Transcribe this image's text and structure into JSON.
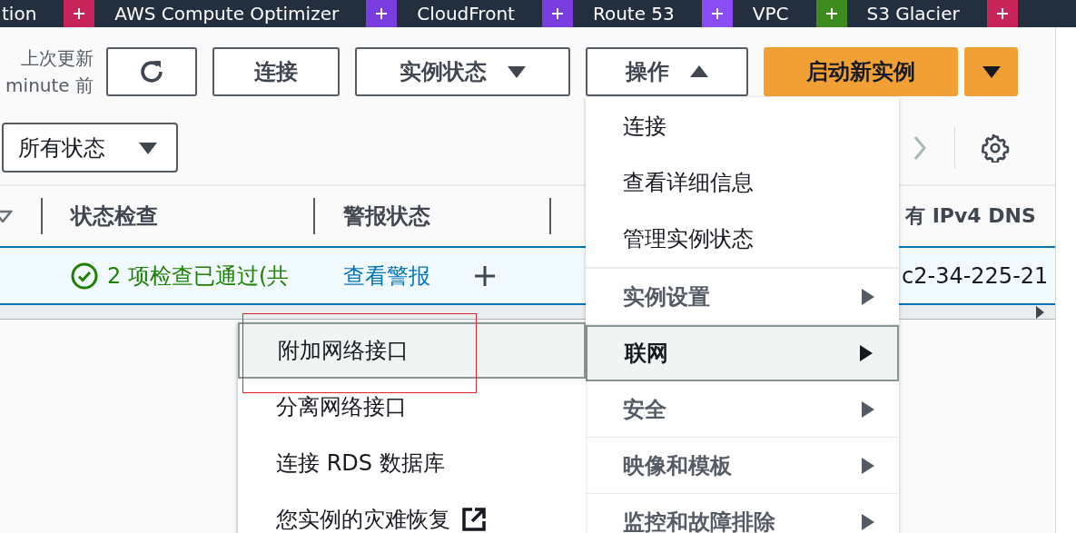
{
  "nav_bar": {
    "items": [
      {
        "label": "tion"
      },
      {
        "label": "AWS Compute Optimizer",
        "color": "#c7245a"
      },
      {
        "label": "CloudFront",
        "color": "#7a3ee0"
      },
      {
        "label": "Route 53",
        "color": "#7a3ee0"
      },
      {
        "label": "VPC",
        "color": "#8a4cf5"
      },
      {
        "label": "S3 Glacier",
        "color": "#3d8a1f"
      },
      {
        "color": "#c7245a"
      }
    ]
  },
  "toolbar": {
    "last_updated": [
      "上次更新",
      "minute 前"
    ],
    "connect_button": "连接",
    "instance_state_button": "实例状态",
    "actions_button": {
      "label": "操作",
      "expanded": true
    },
    "launch_button": "启动新实例"
  },
  "filter": {
    "value": "所有状态"
  },
  "table": {
    "columns": [
      "状态检查",
      "警报状态",
      "有 IPv4 DNS"
    ],
    "rows": [
      {
        "selected": true,
        "status_check": "2 项检查已通过(共",
        "alarm_status": "查看警报",
        "public_dns": "c2-34-225-21"
      }
    ]
  },
  "actions_menu": {
    "items": [
      {
        "label": "连接",
        "kind": "action",
        "selected": false
      },
      {
        "label": "查看详细信息",
        "kind": "action",
        "selected": false
      },
      {
        "label": "管理实例状态",
        "kind": "action",
        "selected": false
      },
      {
        "label": "实例设置",
        "kind": "submenu",
        "selected": false
      },
      {
        "label": "联网",
        "kind": "submenu",
        "selected": true
      },
      {
        "label": "安全",
        "kind": "submenu",
        "selected": false
      },
      {
        "label": "映像和模板",
        "kind": "submenu",
        "selected": false
      },
      {
        "label": "监控和故障排除",
        "kind": "submenu",
        "selected": false
      }
    ]
  },
  "networking_submenu": {
    "items": [
      {
        "label": "附加网络接口",
        "selected": true,
        "outlined": true,
        "external": false
      },
      {
        "label": "分离网络接口",
        "selected": false,
        "outlined": false,
        "external": false
      },
      {
        "label": "连接 RDS 数据库",
        "selected": false,
        "outlined": false,
        "external": false
      },
      {
        "label": "您实例的灾难恢复",
        "selected": false,
        "outlined": false,
        "external": true
      }
    ]
  }
}
